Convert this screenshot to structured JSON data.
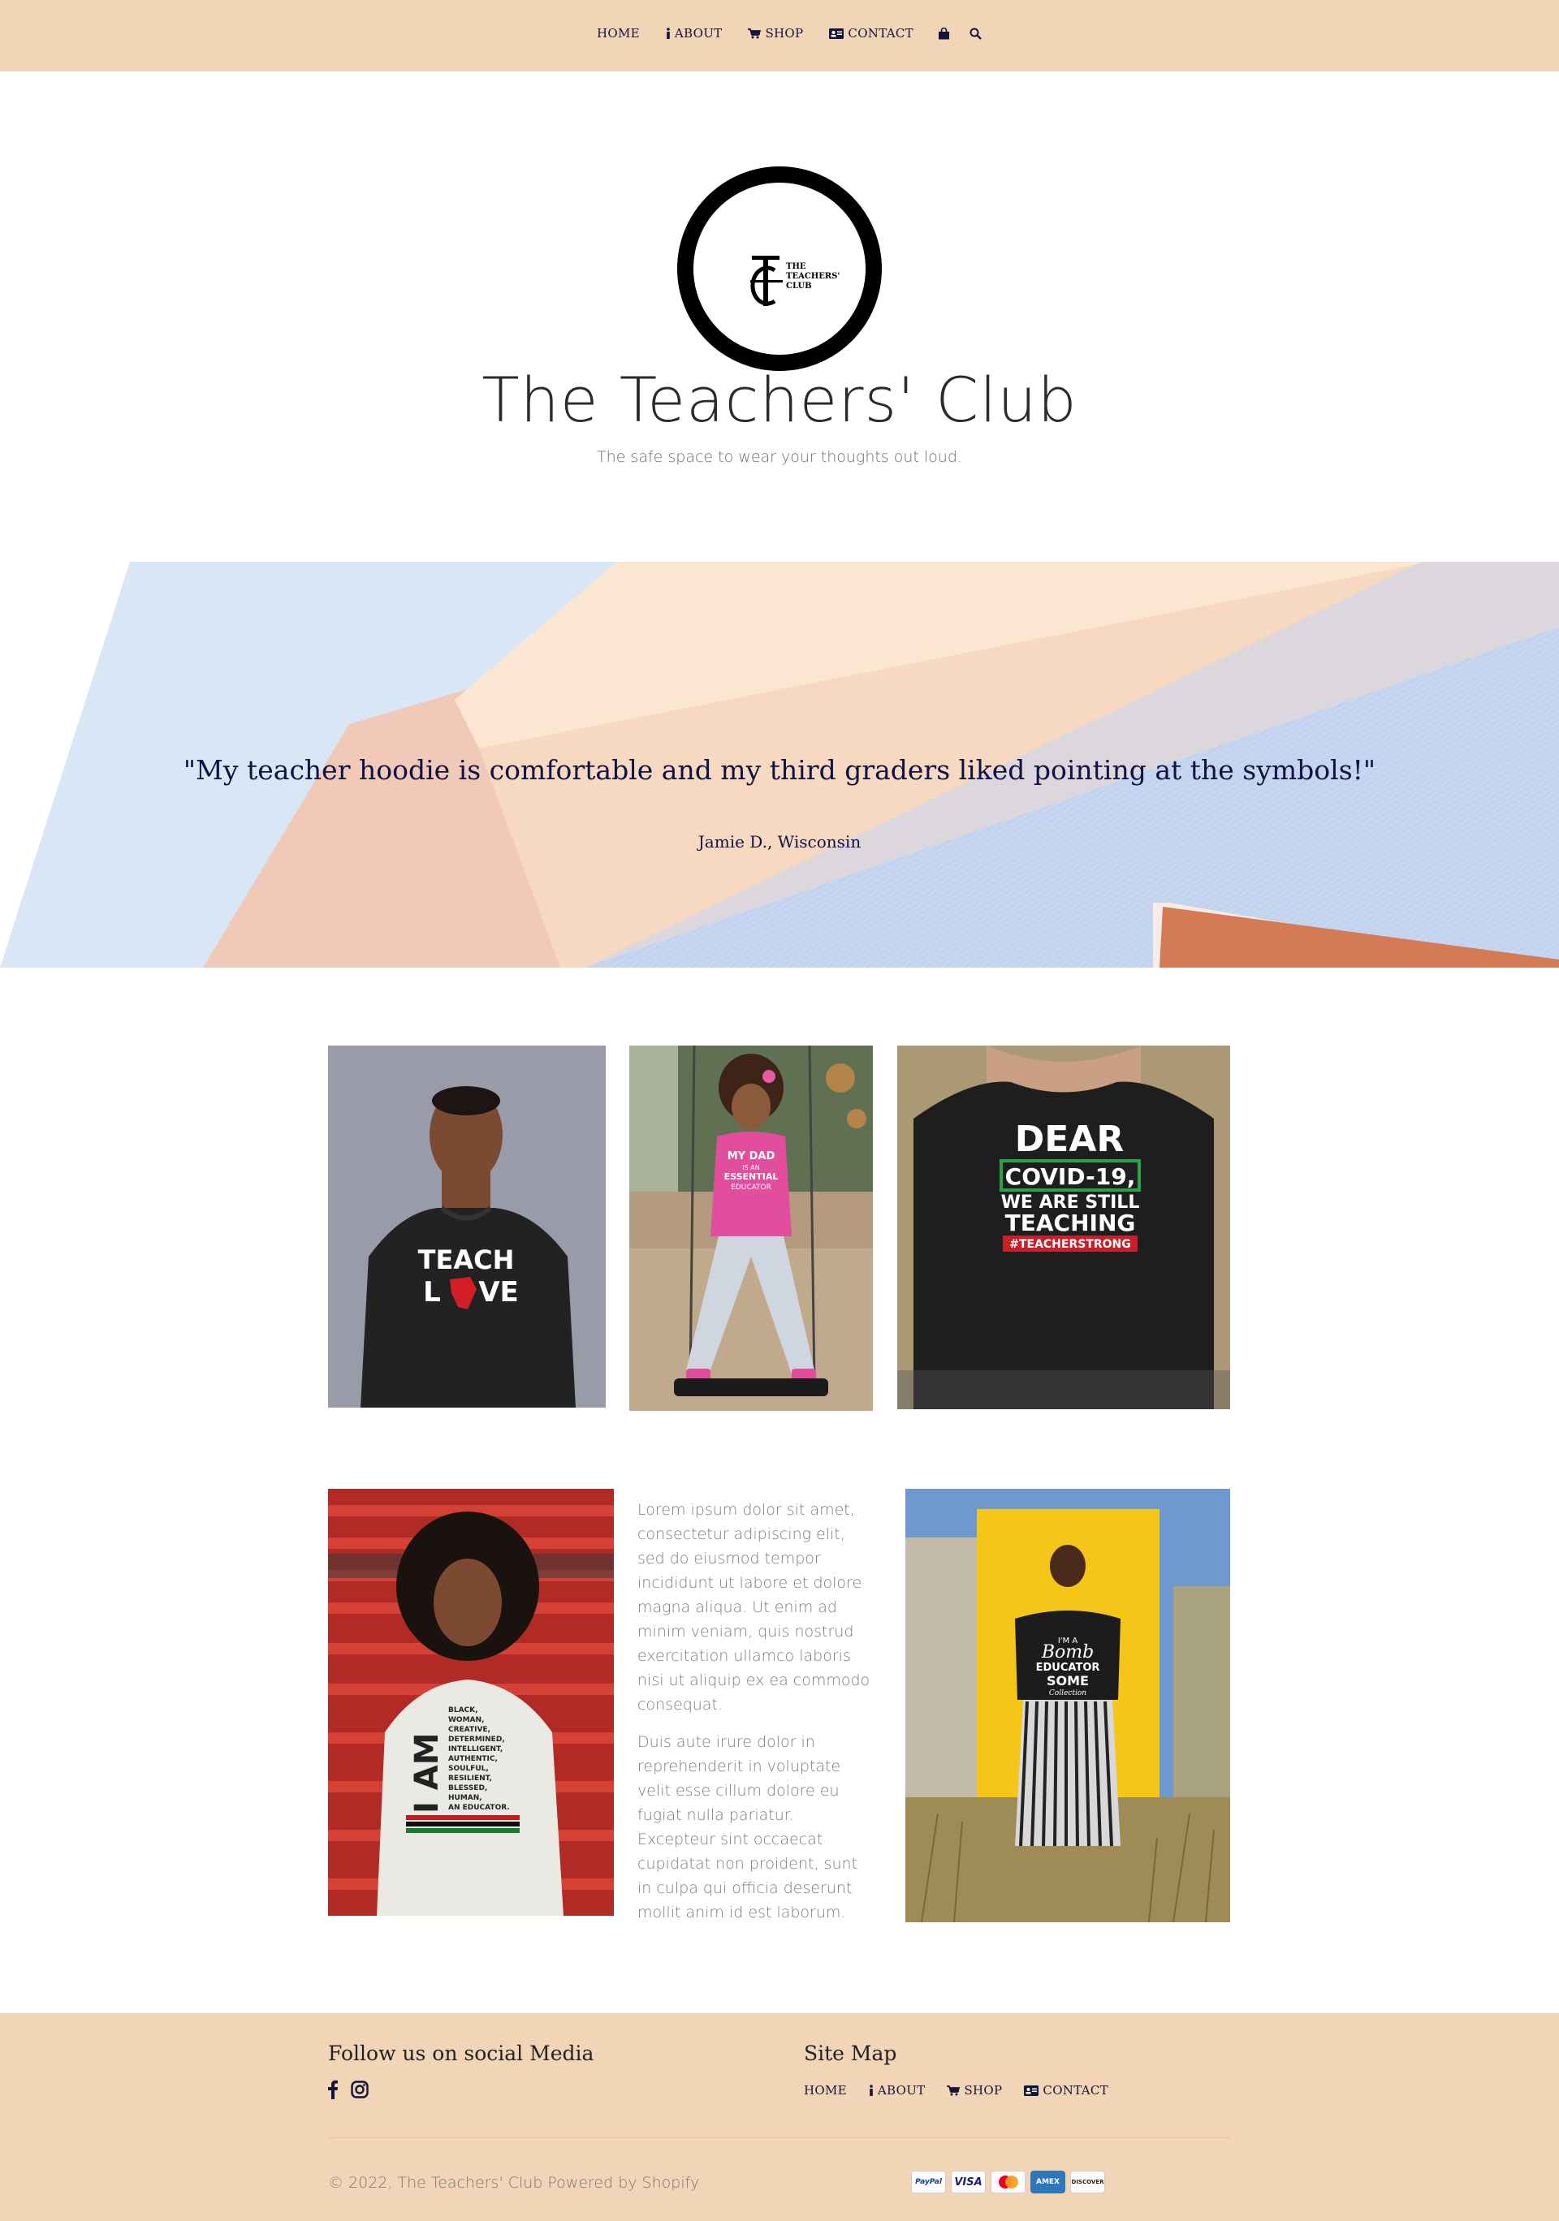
{
  "nav": {
    "items": [
      {
        "label": "HOME",
        "icon": ""
      },
      {
        "label": "ABOUT",
        "icon": "info-icon"
      },
      {
        "label": "SHOP",
        "icon": "cart-icon"
      },
      {
        "label": "CONTACT",
        "icon": "contact-card-icon"
      }
    ],
    "bag_icon": "shopping-bag-icon",
    "search_icon": "search-icon"
  },
  "header": {
    "logo_text": [
      "THE",
      "TEACHERS'",
      "CLUB"
    ],
    "title": "The Teachers' Club",
    "tagline": "The safe space to wear your thoughts out loud."
  },
  "testimonial": {
    "quote": "\"My teacher hoodie is comfortable and my third graders liked pointing at the symbols!\"",
    "author": "Jamie D., Wisconsin"
  },
  "gallery": {
    "shirt_texts": {
      "teach_love": [
        "TEACH",
        "L",
        "VE"
      ],
      "my_dad": [
        "MY DAD",
        "IS AN",
        "ESSENTIAL",
        "EDUCATOR"
      ],
      "dear_covid": [
        "DEAR",
        "COVID-19,",
        "WE ARE STILL",
        "TEACHING",
        "#TEACHERSTRONG"
      ],
      "i_am": [
        "I AM",
        "BLACK,",
        "WOMAN,",
        "CREATIVE,",
        "DETERMINED,",
        "INTELLIGENT,",
        "AUTHENTIC,",
        "SOULFUL,",
        "RESILIENT,",
        "BLESSED,",
        "HUMAN,",
        "AN EDUCATOR."
      ],
      "bomb_educator": [
        "I'M A",
        "Bomb",
        "EDUCATOR",
        "SOME",
        "Collection"
      ]
    },
    "text": [
      "Lorem ipsum dolor sit amet, consectetur adipiscing elit, sed do eiusmod tempor incididunt ut labore et dolore magna aliqua. Ut enim ad minim veniam, quis nostrud exercitation ullamco laboris nisi ut aliquip ex ea commodo consequat.",
      "Duis aute irure dolor in reprehenderit in voluptate velit esse cillum dolore eu fugiat nulla pariatur. Excepteur sint occaecat cupidatat non proident, sunt in culpa qui officia deserunt mollit anim id est laborum."
    ]
  },
  "footer": {
    "social_heading": "Follow us on social Media",
    "social_icons": [
      "facebook-icon",
      "instagram-icon"
    ],
    "sitemap_heading": "Site Map",
    "sitemap": [
      {
        "label": "HOME",
        "icon": ""
      },
      {
        "label": "ABOUT",
        "icon": "info-icon"
      },
      {
        "label": "SHOP",
        "icon": "cart-icon"
      },
      {
        "label": "CONTACT",
        "icon": "contact-card-icon"
      }
    ],
    "copyright": "© 2022, The Teachers' Club Powered by Shopify",
    "payments": [
      "PayPal",
      "VISA",
      "Mastercard",
      "AMEX",
      "DISCOVER"
    ]
  },
  "colors": {
    "nav_bg": "#f2d5b6",
    "nav_text": "#14143c",
    "quote_text": "#111244",
    "body_text": "#7b7b7b"
  }
}
